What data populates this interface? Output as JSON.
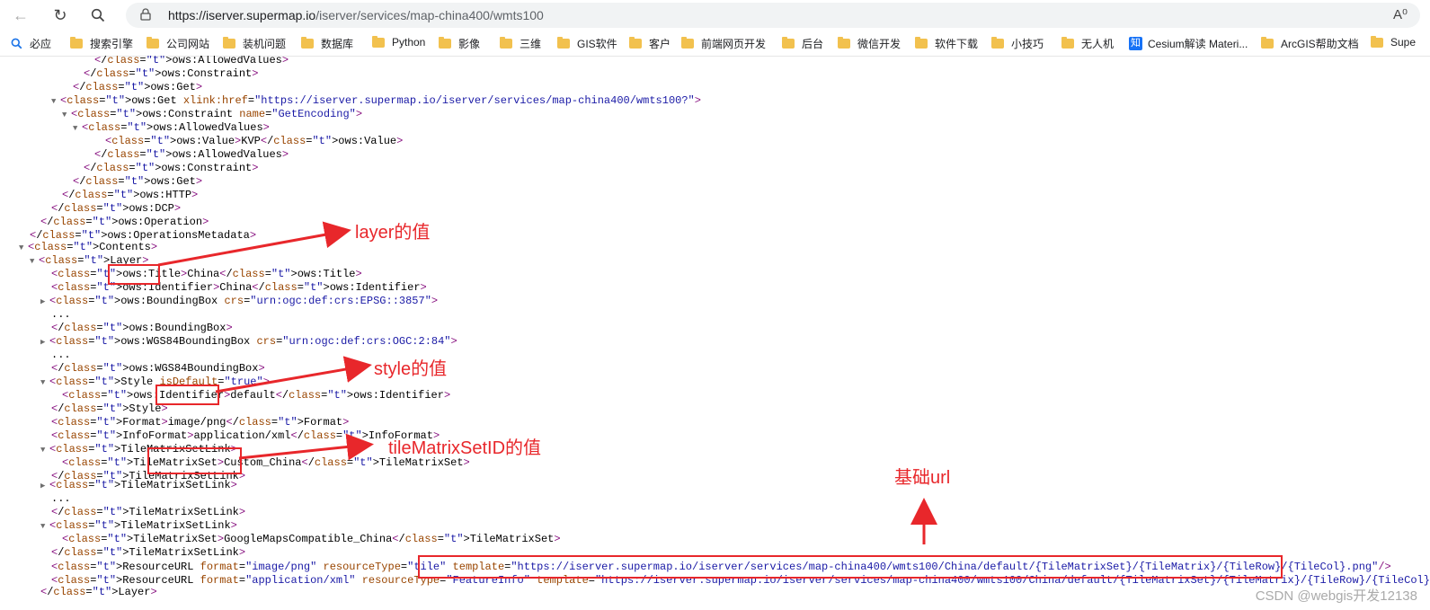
{
  "browser": {
    "url_host": "https://iserver.supermap.io",
    "url_path": "/iserver/services/map-china400/wmts100",
    "reader_label": "A⁰"
  },
  "bookmarks": [
    {
      "label": "必应",
      "icon": "search-icon"
    },
    {
      "label": "搜索引擎",
      "icon": "folder-icon"
    },
    {
      "label": "公司网站",
      "icon": "folder-icon"
    },
    {
      "label": "装机问题",
      "icon": "folder-icon"
    },
    {
      "label": "数据库",
      "icon": "folder-icon"
    },
    {
      "label": "Python",
      "icon": "folder-icon"
    },
    {
      "label": "影像",
      "icon": "folder-icon"
    },
    {
      "label": "三维",
      "icon": "folder-icon"
    },
    {
      "label": "GIS软件",
      "icon": "folder-icon"
    },
    {
      "label": "客户",
      "icon": "folder-icon"
    },
    {
      "label": "前端网页开发",
      "icon": "folder-icon"
    },
    {
      "label": "后台",
      "icon": "folder-icon"
    },
    {
      "label": "微信开发",
      "icon": "folder-icon"
    },
    {
      "label": "软件下载",
      "icon": "folder-icon"
    },
    {
      "label": "小技巧",
      "icon": "folder-icon"
    },
    {
      "label": "无人机",
      "icon": "folder-icon"
    },
    {
      "label": "Cesium解读 Materi...",
      "icon": "zhihu-icon"
    },
    {
      "label": "ArcGIS帮助文档",
      "icon": "folder-icon"
    },
    {
      "label": "Supe",
      "icon": "folder-icon"
    }
  ],
  "xml_lines": [
    {
      "text": "</ows:AllowedValues>",
      "tri": ""
    },
    {
      "text": "</ows:Constraint>",
      "tri": ""
    },
    {
      "text": "</ows:Get>",
      "tri": ""
    },
    {
      "text": "<ows:Get xlink:href=\"https://iserver.supermap.io/iserver/services/map-china400/wmts100?\">",
      "tri": "▼"
    },
    {
      "text": "<ows:Constraint name=\"GetEncoding\">",
      "tri": "▼"
    },
    {
      "text": "<ows:AllowedValues>",
      "tri": "▼"
    },
    {
      "text": "<ows:Value>KVP</ows:Value>",
      "tri": ""
    },
    {
      "text": "</ows:AllowedValues>",
      "tri": ""
    },
    {
      "text": "</ows:Constraint>",
      "tri": ""
    },
    {
      "text": "</ows:Get>",
      "tri": ""
    },
    {
      "text": "</ows:HTTP>",
      "tri": ""
    },
    {
      "text": "</ows:DCP>",
      "tri": ""
    },
    {
      "text": "</ows:Operation>",
      "tri": ""
    },
    {
      "text": "</ows:OperationsMetadata>",
      "tri": ""
    },
    {
      "text": "<Contents>",
      "tri": "▼"
    },
    {
      "text": "<Layer>",
      "tri": "▼"
    },
    {
      "text": "<ows:Title>China</ows:Title>",
      "tri": ""
    },
    {
      "text": "<ows:Identifier>China</ows:Identifier>",
      "tri": ""
    },
    {
      "text": "<ows:BoundingBox crs=\"urn:ogc:def:crs:EPSG::3857\">",
      "tri": "▶"
    },
    {
      "text": "...",
      "tri": ""
    },
    {
      "text": "</ows:BoundingBox>",
      "tri": ""
    },
    {
      "text": "<ows:WGS84BoundingBox crs=\"urn:ogc:def:crs:OGC:2:84\">",
      "tri": "▶"
    },
    {
      "text": "...",
      "tri": ""
    },
    {
      "text": "</ows:WGS84BoundingBox>",
      "tri": ""
    },
    {
      "text": "<Style isDefault=\"true\">",
      "tri": "▼"
    },
    {
      "text": "<ows:Identifier>default</ows:Identifier>",
      "tri": ""
    },
    {
      "text": "</Style>",
      "tri": ""
    },
    {
      "text": "<Format>image/png</Format>",
      "tri": ""
    },
    {
      "text": "<InfoFormat>application/xml</InfoFormat>",
      "tri": ""
    },
    {
      "text": "<TileMatrixSetLink>",
      "tri": "▼"
    },
    {
      "text": "<TileMatrixSet>Custom_China</TileMatrixSet>",
      "tri": ""
    },
    {
      "text": "</TileMatrixSetLink>",
      "tri": ""
    },
    {
      "text": "<TileMatrixSetLink>",
      "tri": "▶"
    },
    {
      "text": "...",
      "tri": ""
    },
    {
      "text": "</TileMatrixSetLink>",
      "tri": ""
    },
    {
      "text": "<TileMatrixSetLink>",
      "tri": "▼"
    },
    {
      "text": "<TileMatrixSet>GoogleMapsCompatible_China</TileMatrixSet>",
      "tri": ""
    },
    {
      "text": "</TileMatrixSetLink>",
      "tri": ""
    },
    {
      "text": "<ResourceURL format=\"image/png\" resourceType=\"tile\" template=\"https://iserver.supermap.io/iserver/services/map-china400/wmts100/China/default/{TileMatrixSet}/{TileMatrix}/{TileRow}/{TileCol}.png\"/>",
      "tri": ""
    },
    {
      "text": "<ResourceURL format=\"application/xml\" resourceType=\"FeatureInfo\" template=\"https://iserver.supermap.io/iserver/services/map-china400/wmts100/China/default/{TileMatrixSet}/{TileMatrix}/{TileRow}/{TileCol}/{J}/{I}.xml\"/>",
      "tri": ""
    },
    {
      "text": "</Layer>",
      "tri": ""
    }
  ],
  "annotations": {
    "layer_note": "layer的值",
    "style_note": "style的值",
    "tms_note": "tileMatrixSetID的值",
    "base_url_note": "基础url"
  },
  "watermark": "CSDN @webgis开发12138",
  "colors": {
    "annotation": "#e8272b",
    "tag": "#881280",
    "attr": "#994500",
    "value": "#1a1aa6"
  }
}
